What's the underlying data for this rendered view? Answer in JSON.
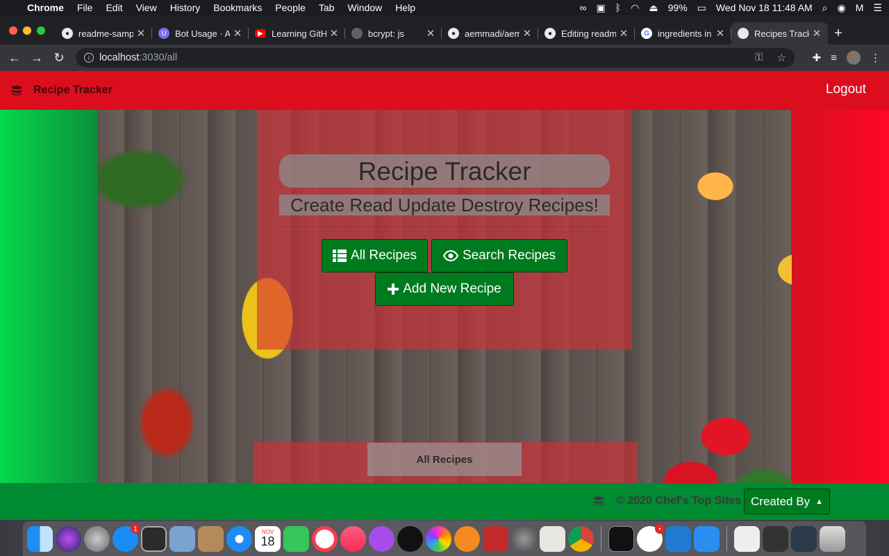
{
  "menubar": {
    "app": "Chrome",
    "items": [
      "File",
      "Edit",
      "View",
      "History",
      "Bookmarks",
      "People",
      "Tab",
      "Window",
      "Help"
    ],
    "battery": "99%",
    "clock": "Wed Nov 18  11:48 AM"
  },
  "tabs": [
    {
      "title": "readme-samp",
      "icon": "github-icon"
    },
    {
      "title": "Bot Usage · A",
      "icon": "bot-icon"
    },
    {
      "title": "Learning GitH",
      "icon": "youtube-icon"
    },
    {
      "title": "bcrypt: js",
      "icon": "globe-icon"
    },
    {
      "title": "aemmadi/aem",
      "icon": "github-icon"
    },
    {
      "title": "Editing readm",
      "icon": "github-icon"
    },
    {
      "title": "ingredients in",
      "icon": "google-icon"
    },
    {
      "title": "Recipes Track",
      "icon": "globe-icon",
      "active": true
    }
  ],
  "address": {
    "host": "localhost",
    "path": ":3030/all"
  },
  "navbar": {
    "brand": "Recipe Tracker",
    "logout": "Logout"
  },
  "hero": {
    "title": "Recipe Tracker",
    "subtitle": "Create Read Update Destroy Recipes!",
    "buttons": {
      "all": "All Recipes",
      "search": "Search Recipes",
      "add": "Add New Recipe"
    }
  },
  "section": {
    "label": "All Recipes"
  },
  "footer": {
    "copyright": "© 2020 Chef's Top Sites",
    "created_by": "Created By"
  },
  "dock": {
    "calendar_month": "NOV",
    "calendar_day": "18",
    "appstore_badge": "1",
    "slack_badge": "•"
  },
  "colors": {
    "nav": "#dc0d1c",
    "button": "#007a1f",
    "footer": "#008a32"
  }
}
